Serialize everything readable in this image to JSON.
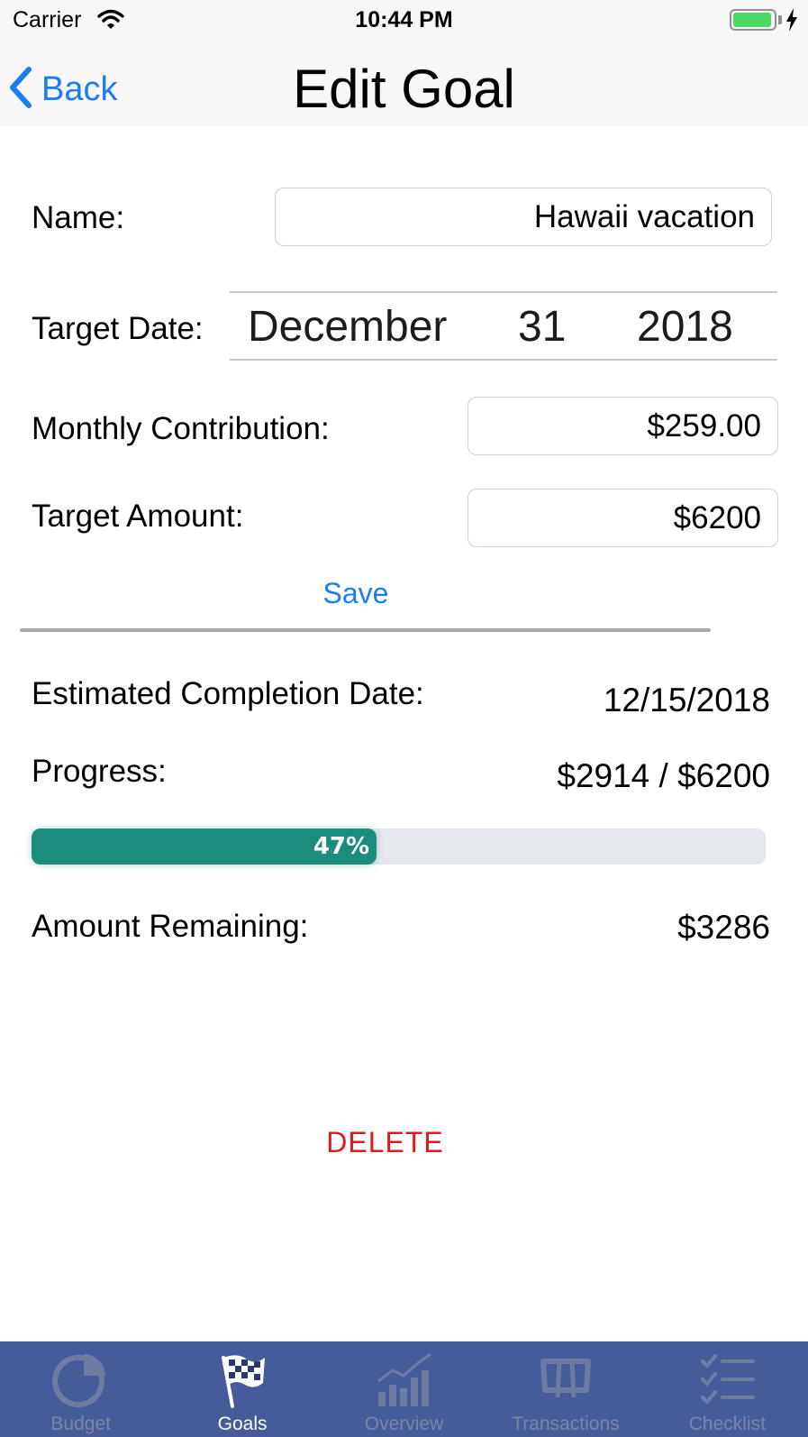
{
  "status_bar": {
    "carrier": "Carrier",
    "time": "10:44 PM",
    "battery_level": 0.95
  },
  "nav": {
    "back_label": "Back",
    "title": "Edit Goal"
  },
  "form": {
    "name_label": "Name:",
    "name_value": "Hawaii vacation",
    "target_date_label": "Target Date:",
    "target_date": {
      "month": "December",
      "day": "31",
      "year": "2018"
    },
    "monthly_label": "Monthly Contribution:",
    "monthly_value": "$259.00",
    "target_amount_label": "Target Amount:",
    "target_amount_value": "$6200",
    "save_label": "Save"
  },
  "summary": {
    "completion_label": "Estimated Completion Date:",
    "completion_value": "12/15/2018",
    "progress_label": "Progress:",
    "progress_value": "$2914 / $6200",
    "progress_percent_text": "47%",
    "progress_fraction": 0.47,
    "remaining_label": "Amount Remaining:",
    "remaining_value": "$3286",
    "delete_label": "DELETE"
  },
  "tabs": [
    {
      "label": "Budget",
      "icon": "pie-chart-icon",
      "active": false
    },
    {
      "label": "Goals",
      "icon": "checkered-flag-icon",
      "active": true
    },
    {
      "label": "Overview",
      "icon": "bar-chart-icon",
      "active": false
    },
    {
      "label": "Transactions",
      "icon": "receipt-icon",
      "active": false
    },
    {
      "label": "Checklist",
      "icon": "checklist-icon",
      "active": false
    }
  ],
  "colors": {
    "accent": "#1b7cf5",
    "delete": "#e3191c",
    "progress": "#1c8d7c",
    "tab_bar": "#455b9a"
  }
}
